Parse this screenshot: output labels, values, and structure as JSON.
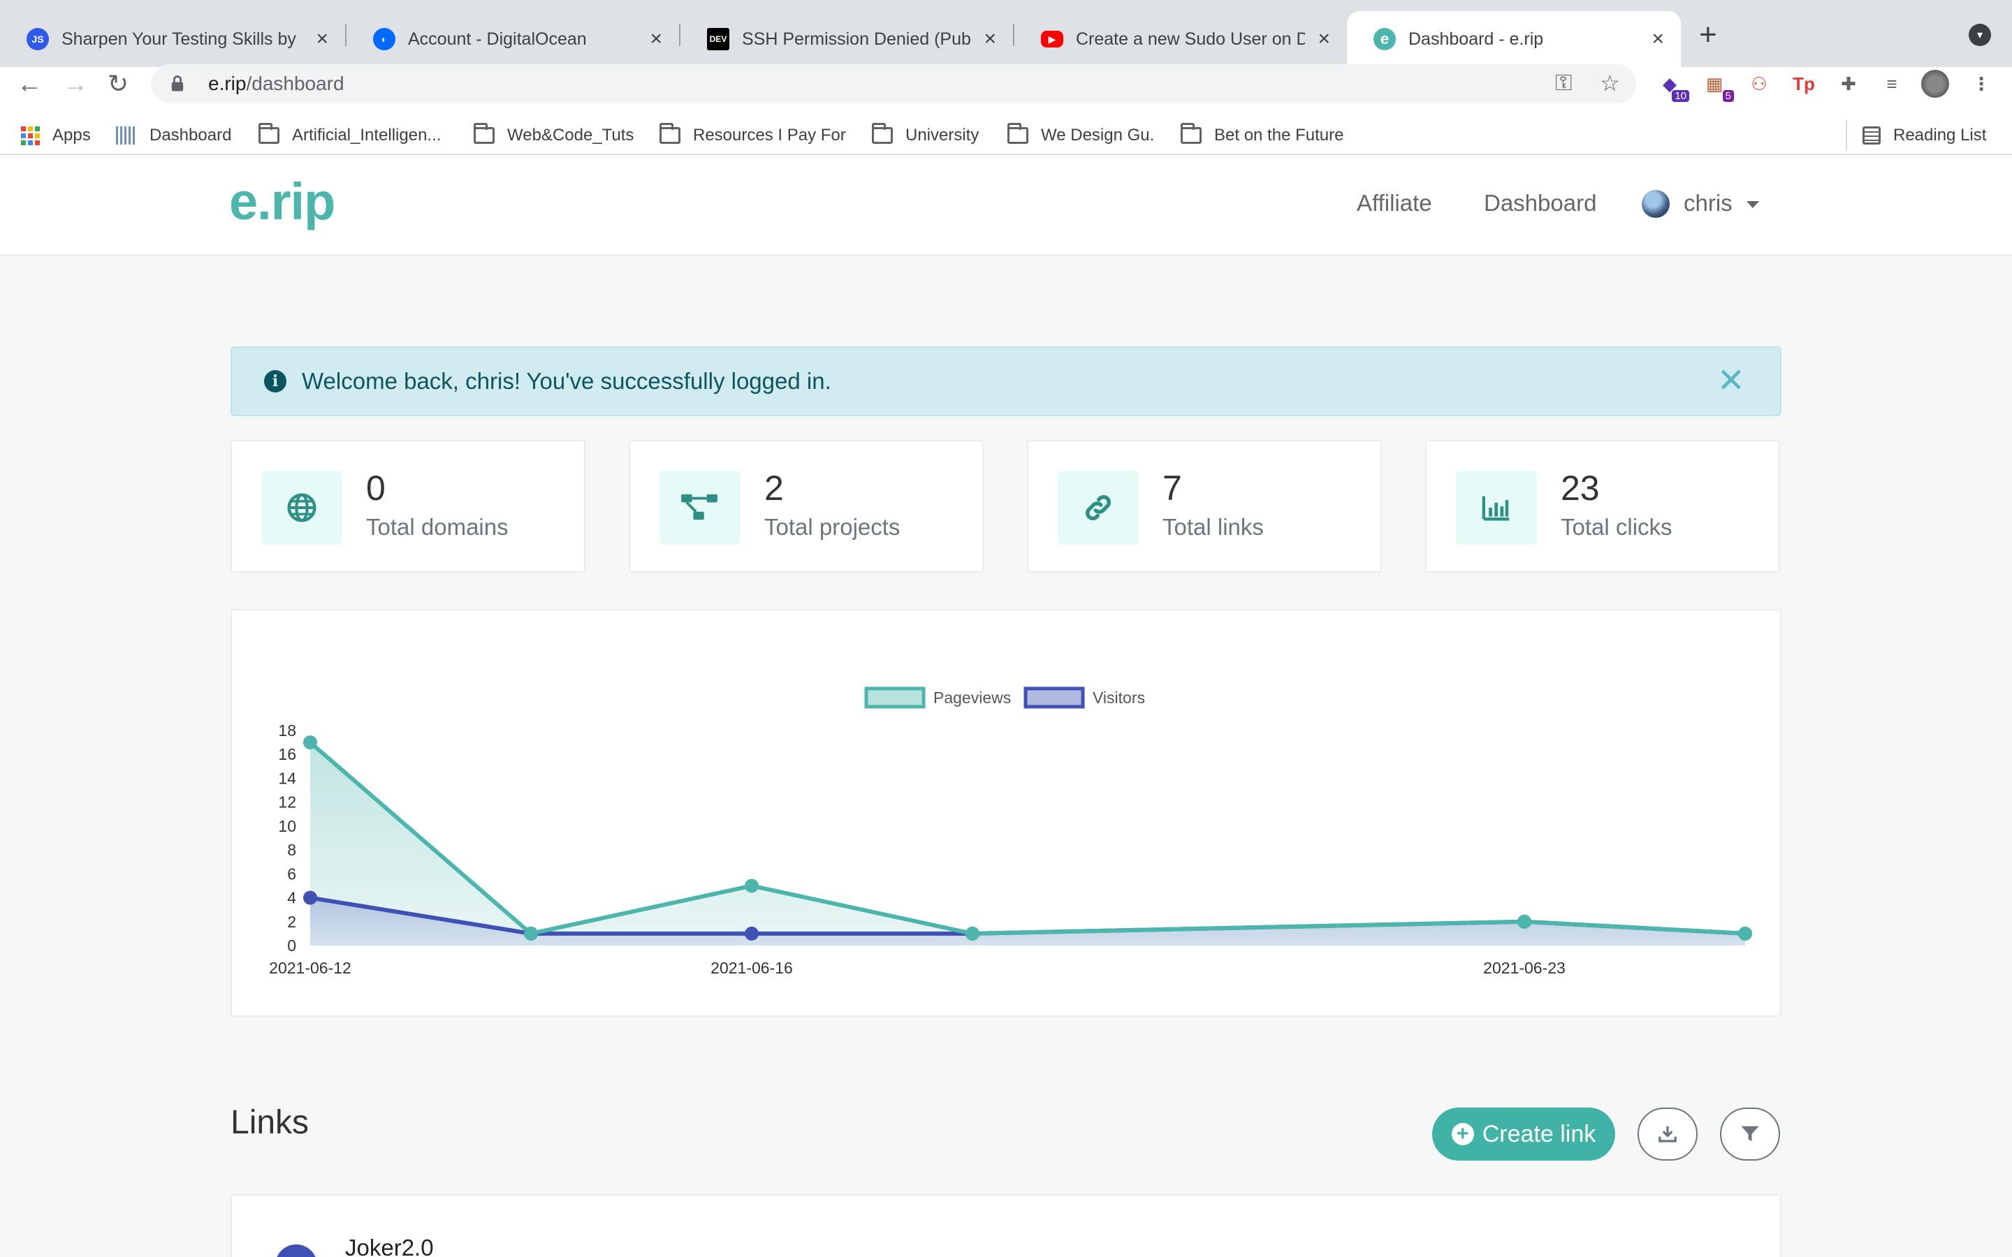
{
  "browser": {
    "tabs": [
      {
        "title": "Sharpen Your Testing Skills by",
        "favicon": "js-icon",
        "active": false
      },
      {
        "title": "Account - DigitalOcean",
        "favicon": "digitalocean-icon",
        "active": false
      },
      {
        "title": "SSH Permission Denied (Public",
        "favicon": "dev-icon",
        "active": false
      },
      {
        "title": "Create a new Sudo User on Dig",
        "favicon": "youtube-icon",
        "active": false
      },
      {
        "title": "Dashboard - e.rip",
        "favicon": "erip-icon",
        "active": true
      }
    ],
    "url_host": "e.rip",
    "url_path": "/dashboard",
    "extensions": [
      {
        "name": "graduation-cap-icon",
        "badge": "10"
      },
      {
        "name": "extension-badge-icon",
        "badge": "5"
      },
      {
        "name": "sitemap-icon",
        "badge": ""
      },
      {
        "name": "tp-icon",
        "label": "Tp"
      },
      {
        "name": "puzzle-icon"
      },
      {
        "name": "media-icon"
      }
    ],
    "bookmarks": [
      {
        "label": "Apps",
        "icon": "apps-grid-icon"
      },
      {
        "label": "Dashboard",
        "icon": "dashboard-icon"
      },
      {
        "label": "Artificial_Intelligen...",
        "icon": "folder-icon"
      },
      {
        "label": "Web&Code_Tuts",
        "icon": "folder-icon"
      },
      {
        "label": "Resources I Pay For",
        "icon": "folder-icon"
      },
      {
        "label": "University",
        "icon": "folder-icon"
      },
      {
        "label": "We Design Gu.",
        "icon": "folder-icon"
      },
      {
        "label": "Bet on the Future",
        "icon": "folder-icon"
      }
    ],
    "reading_list": "Reading List"
  },
  "site": {
    "brand": "e.rip",
    "nav": {
      "affiliate": "Affiliate",
      "dashboard": "Dashboard",
      "user": "chris"
    },
    "accent": "#4db6ac"
  },
  "alert": {
    "message": "Welcome back, chris! You've successfully logged in."
  },
  "stats": [
    {
      "value": "0",
      "label": "Total domains",
      "icon": "globe-icon"
    },
    {
      "value": "2",
      "label": "Total projects",
      "icon": "project-tree-icon"
    },
    {
      "value": "7",
      "label": "Total links",
      "icon": "link-icon"
    },
    {
      "value": "23",
      "label": "Total clicks",
      "icon": "bar-chart-icon"
    }
  ],
  "chart_data": {
    "type": "line",
    "title": "",
    "x": [
      "2021-06-12",
      "2021-06-14",
      "2021-06-16",
      "2021-06-18",
      "2021-06-23",
      "2021-06-25"
    ],
    "x_tick_labels": [
      "2021-06-12",
      "2021-06-16",
      "2021-06-23"
    ],
    "series": [
      {
        "name": "Pageviews",
        "values": [
          17,
          1,
          5,
          1,
          2,
          1
        ],
        "color": "#4db6ac",
        "fill": "#4db6ac"
      },
      {
        "name": "Visitors",
        "values": [
          4,
          1,
          1,
          1,
          2,
          1
        ],
        "color": "#3f51b5",
        "fill": "#3f51b5"
      }
    ],
    "ylim": [
      0,
      18
    ],
    "yticks": [
      0,
      2,
      4,
      6,
      8,
      10,
      12,
      14,
      16,
      18
    ],
    "legend_position": "top-center",
    "grid": false
  },
  "links": {
    "title": "Links",
    "create_label": "Create link",
    "first_item": "Joker2.0"
  }
}
